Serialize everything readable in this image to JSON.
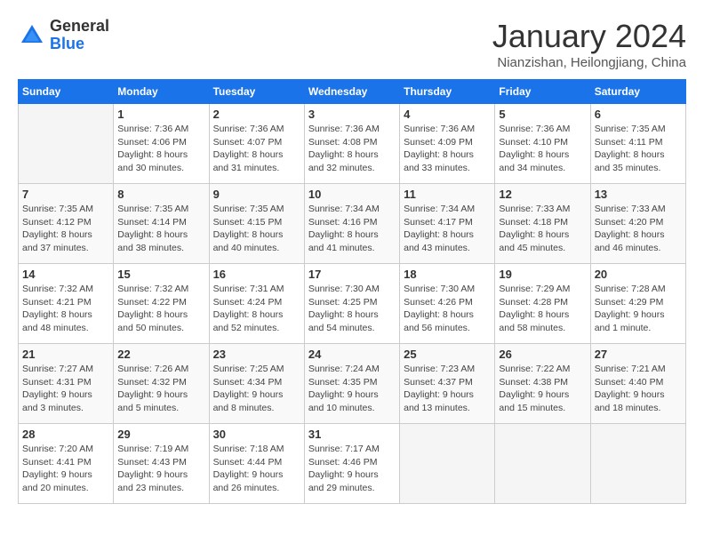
{
  "logo": {
    "general": "General",
    "blue": "Blue"
  },
  "title": "January 2024",
  "subtitle": "Nianzishan, Heilongjiang, China",
  "weekdays": [
    "Sunday",
    "Monday",
    "Tuesday",
    "Wednesday",
    "Thursday",
    "Friday",
    "Saturday"
  ],
  "weeks": [
    [
      {
        "day": "",
        "info": ""
      },
      {
        "day": "1",
        "info": "Sunrise: 7:36 AM\nSunset: 4:06 PM\nDaylight: 8 hours\nand 30 minutes."
      },
      {
        "day": "2",
        "info": "Sunrise: 7:36 AM\nSunset: 4:07 PM\nDaylight: 8 hours\nand 31 minutes."
      },
      {
        "day": "3",
        "info": "Sunrise: 7:36 AM\nSunset: 4:08 PM\nDaylight: 8 hours\nand 32 minutes."
      },
      {
        "day": "4",
        "info": "Sunrise: 7:36 AM\nSunset: 4:09 PM\nDaylight: 8 hours\nand 33 minutes."
      },
      {
        "day": "5",
        "info": "Sunrise: 7:36 AM\nSunset: 4:10 PM\nDaylight: 8 hours\nand 34 minutes."
      },
      {
        "day": "6",
        "info": "Sunrise: 7:35 AM\nSunset: 4:11 PM\nDaylight: 8 hours\nand 35 minutes."
      }
    ],
    [
      {
        "day": "7",
        "info": "Sunrise: 7:35 AM\nSunset: 4:12 PM\nDaylight: 8 hours\nand 37 minutes."
      },
      {
        "day": "8",
        "info": "Sunrise: 7:35 AM\nSunset: 4:14 PM\nDaylight: 8 hours\nand 38 minutes."
      },
      {
        "day": "9",
        "info": "Sunrise: 7:35 AM\nSunset: 4:15 PM\nDaylight: 8 hours\nand 40 minutes."
      },
      {
        "day": "10",
        "info": "Sunrise: 7:34 AM\nSunset: 4:16 PM\nDaylight: 8 hours\nand 41 minutes."
      },
      {
        "day": "11",
        "info": "Sunrise: 7:34 AM\nSunset: 4:17 PM\nDaylight: 8 hours\nand 43 minutes."
      },
      {
        "day": "12",
        "info": "Sunrise: 7:33 AM\nSunset: 4:18 PM\nDaylight: 8 hours\nand 45 minutes."
      },
      {
        "day": "13",
        "info": "Sunrise: 7:33 AM\nSunset: 4:20 PM\nDaylight: 8 hours\nand 46 minutes."
      }
    ],
    [
      {
        "day": "14",
        "info": "Sunrise: 7:32 AM\nSunset: 4:21 PM\nDaylight: 8 hours\nand 48 minutes."
      },
      {
        "day": "15",
        "info": "Sunrise: 7:32 AM\nSunset: 4:22 PM\nDaylight: 8 hours\nand 50 minutes."
      },
      {
        "day": "16",
        "info": "Sunrise: 7:31 AM\nSunset: 4:24 PM\nDaylight: 8 hours\nand 52 minutes."
      },
      {
        "day": "17",
        "info": "Sunrise: 7:30 AM\nSunset: 4:25 PM\nDaylight: 8 hours\nand 54 minutes."
      },
      {
        "day": "18",
        "info": "Sunrise: 7:30 AM\nSunset: 4:26 PM\nDaylight: 8 hours\nand 56 minutes."
      },
      {
        "day": "19",
        "info": "Sunrise: 7:29 AM\nSunset: 4:28 PM\nDaylight: 8 hours\nand 58 minutes."
      },
      {
        "day": "20",
        "info": "Sunrise: 7:28 AM\nSunset: 4:29 PM\nDaylight: 9 hours\nand 1 minute."
      }
    ],
    [
      {
        "day": "21",
        "info": "Sunrise: 7:27 AM\nSunset: 4:31 PM\nDaylight: 9 hours\nand 3 minutes."
      },
      {
        "day": "22",
        "info": "Sunrise: 7:26 AM\nSunset: 4:32 PM\nDaylight: 9 hours\nand 5 minutes."
      },
      {
        "day": "23",
        "info": "Sunrise: 7:25 AM\nSunset: 4:34 PM\nDaylight: 9 hours\nand 8 minutes."
      },
      {
        "day": "24",
        "info": "Sunrise: 7:24 AM\nSunset: 4:35 PM\nDaylight: 9 hours\nand 10 minutes."
      },
      {
        "day": "25",
        "info": "Sunrise: 7:23 AM\nSunset: 4:37 PM\nDaylight: 9 hours\nand 13 minutes."
      },
      {
        "day": "26",
        "info": "Sunrise: 7:22 AM\nSunset: 4:38 PM\nDaylight: 9 hours\nand 15 minutes."
      },
      {
        "day": "27",
        "info": "Sunrise: 7:21 AM\nSunset: 4:40 PM\nDaylight: 9 hours\nand 18 minutes."
      }
    ],
    [
      {
        "day": "28",
        "info": "Sunrise: 7:20 AM\nSunset: 4:41 PM\nDaylight: 9 hours\nand 20 minutes."
      },
      {
        "day": "29",
        "info": "Sunrise: 7:19 AM\nSunset: 4:43 PM\nDaylight: 9 hours\nand 23 minutes."
      },
      {
        "day": "30",
        "info": "Sunrise: 7:18 AM\nSunset: 4:44 PM\nDaylight: 9 hours\nand 26 minutes."
      },
      {
        "day": "31",
        "info": "Sunrise: 7:17 AM\nSunset: 4:46 PM\nDaylight: 9 hours\nand 29 minutes."
      },
      {
        "day": "",
        "info": ""
      },
      {
        "day": "",
        "info": ""
      },
      {
        "day": "",
        "info": ""
      }
    ]
  ]
}
